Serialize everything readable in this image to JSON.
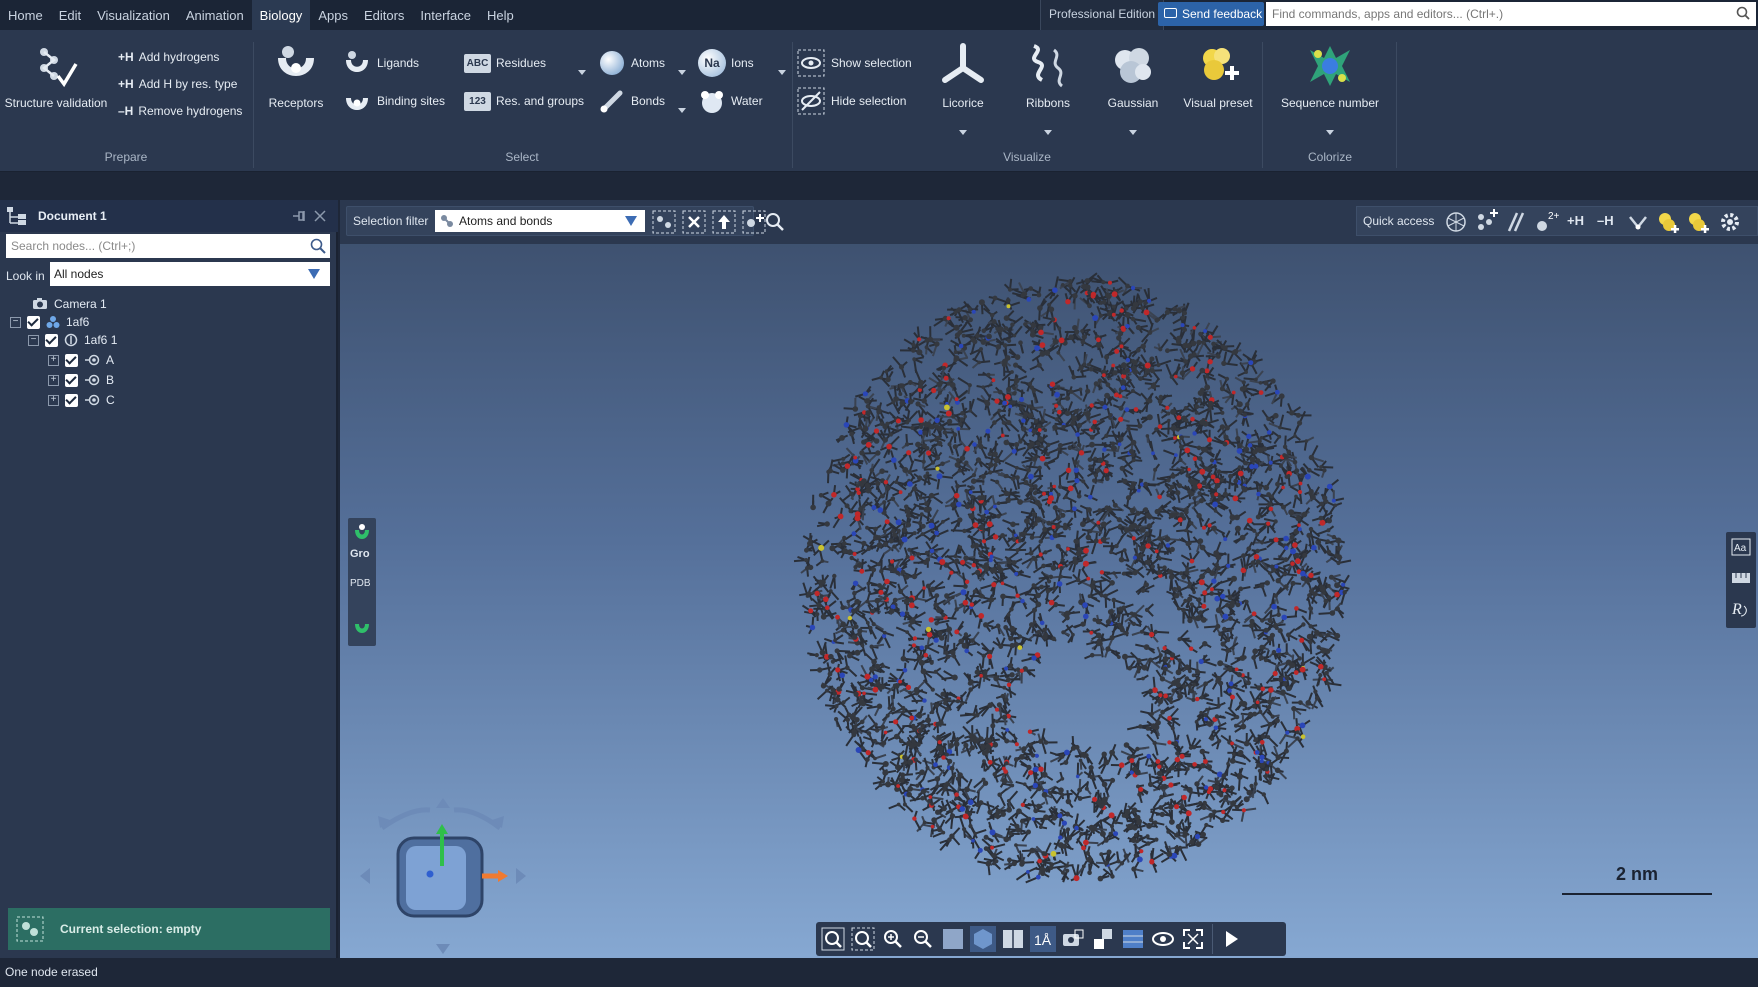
{
  "menubar": {
    "items": [
      "Home",
      "Edit",
      "Visualization",
      "Animation",
      "Biology",
      "Apps",
      "Editors",
      "Interface",
      "Help"
    ],
    "active": "Biology",
    "edition": "Professional Edition",
    "feedback": "Send feedback",
    "search_placeholder": "Find commands, apps and editors... (Ctrl+.)"
  },
  "ribbon": {
    "groups": {
      "prepare": "Prepare",
      "select": "Select",
      "visualize": "Visualize",
      "colorize": "Colorize"
    },
    "prepare": {
      "structure_validation": "Structure validation",
      "add_hydrogens": "Add hydrogens",
      "add_h_by_res": "Add H by res. type",
      "remove_hydrogens": "Remove hydrogens",
      "add_prefix": "+H",
      "remove_prefix": "–H"
    },
    "select": {
      "receptors": "Receptors",
      "ligands": "Ligands",
      "binding_sites": "Binding sites",
      "residues": "Residues",
      "res_groups": "Res. and groups",
      "abc_icon": "ABC",
      "num_icon": "123",
      "atoms": "Atoms",
      "bonds": "Bonds",
      "ions": "Ions",
      "na_icon": "Na",
      "water": "Water",
      "show_selection": "Show selection",
      "hide_selection": "Hide selection"
    },
    "visualize": {
      "licorice": "Licorice",
      "ribbons": "Ribbons",
      "gaussian": "Gaussian",
      "visual_preset": "Visual preset"
    },
    "colorize": {
      "sequence_number": "Sequence number"
    }
  },
  "document": {
    "title": "Document 1",
    "search_placeholder": "Search nodes... (Ctrl+;)",
    "look_in_label": "Look in",
    "look_in_value": "All nodes",
    "tree": [
      {
        "label": "Camera 1",
        "depth": 0
      },
      {
        "label": "1af6",
        "depth": 0
      },
      {
        "label": "1af6 1",
        "depth": 1
      },
      {
        "label": "A",
        "depth": 2
      },
      {
        "label": "B",
        "depth": 2
      },
      {
        "label": "C",
        "depth": 2
      }
    ],
    "selection_status": "Current selection: empty"
  },
  "viewport": {
    "selection_filter_label": "Selection filter",
    "selection_filter_value": "Atoms and bonds",
    "quick_access_label": "Quick access",
    "quick_h_add": "+H",
    "quick_h_remove": "–H",
    "left_tools": {
      "gro": "Gro",
      "pdb": "PDB"
    },
    "scale_label": "2 nm"
  },
  "status": {
    "message": "One node erased"
  },
  "colors": {
    "ribbon_bg": "#2b384f",
    "accent": "#2c63a8",
    "selection_bg": "#2c6e63"
  }
}
